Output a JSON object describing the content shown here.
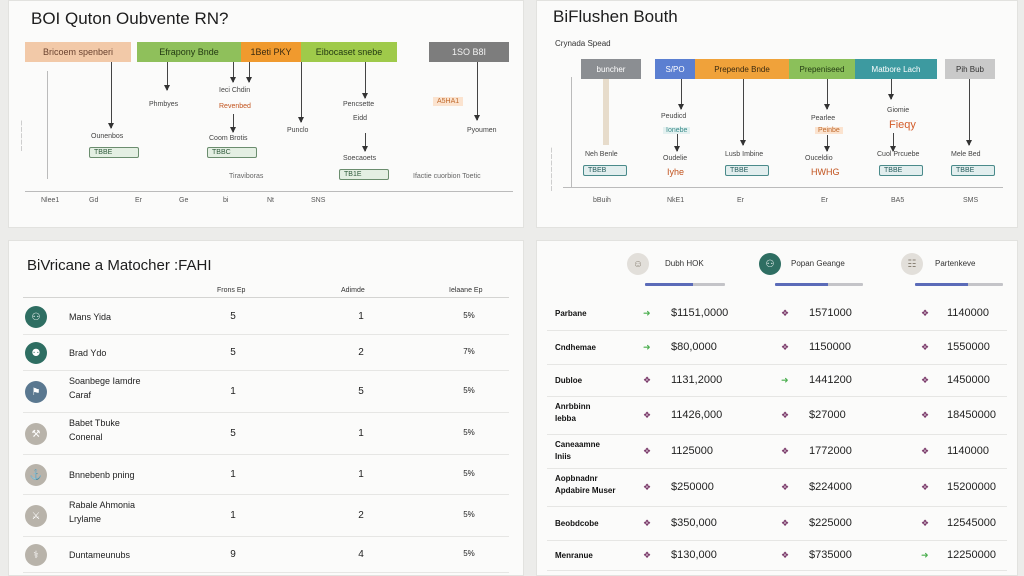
{
  "tl": {
    "title": "BOI Quton Oubvente RN?",
    "bars": [
      "Bricoem spenberi",
      "Efrapony Bnde",
      "1Beti PKY",
      "Eibocaset snebe",
      "1SO B8I"
    ],
    "l1": "Phmbyes",
    "l2a": "Ieci Chdin",
    "l2b": "Revenbed",
    "l3": "Punclo",
    "l4a": "Pencsette",
    "l4b": "Eidd",
    "l5a": "A5HA1",
    "l5b": "Pyoumen",
    "l6": "Ounenbos",
    "l7": "Coom Brotis",
    "l8": "Soecaoets",
    "tag1": "TBBE",
    "tag2": "TBBC",
    "tag3": "TB1E",
    "mid1": "Tiraviboras",
    "mid2": "Ifactie cuorbion Toetic",
    "xt": [
      "Nlee1",
      "Gd",
      "Er",
      "Ge",
      "bi",
      "Nt",
      "SNS"
    ]
  },
  "tr": {
    "title": "BiFlushen Bouth",
    "sub": "Crynada Spead",
    "bars": [
      "buncher",
      "S/PO",
      "Prepende Bnde",
      "Prepeniseed",
      "Matbore Lach",
      "Pih Bub"
    ],
    "la": "Vieste",
    "lb": "Peudicd",
    "lb2": "Ionebe",
    "lc": "Pearlee",
    "lc2": "Peinbe",
    "ld": "Giomie",
    "ld2": "Fieqy",
    "l1": "Neh Benle",
    "l2": "Oudelie",
    "l2b": "Iyhe",
    "l3": "Lusb Imbine",
    "l4": "Ouceldio",
    "l4b": "HWHG",
    "l5": "Cuol Prcuebe",
    "l6": "Mele Bed",
    "tag1": "TBEB",
    "tag2": "TBBE",
    "tag3": "TBBE",
    "tag4": "TBBE",
    "xt": [
      "bBuih",
      "NkE1",
      "Er",
      "Er",
      "BA5",
      "SMS"
    ]
  },
  "bl": {
    "title": "BiVricane a Matocher :FAHI",
    "h1": "Frons Ep",
    "h2": "Adimde",
    "h3": "Ielaane Ep",
    "rows": [
      {
        "n1": "Mans Yida",
        "n2": "",
        "a": "5",
        "b": "1",
        "c": "5%",
        "color": "#2e6e62",
        "glyph": "⚇"
      },
      {
        "n1": "Brad Ydo",
        "n2": "",
        "a": "5",
        "b": "2",
        "c": "7%",
        "color": "#2e6e62",
        "glyph": "⚉"
      },
      {
        "n1": "Soanbege Iamdre",
        "n2": "Caraf",
        "a": "1",
        "b": "5",
        "c": "5%",
        "color": "#5a7890",
        "glyph": "⚑"
      },
      {
        "n1": "Babet Tbuke",
        "n2": "Conenal",
        "a": "5",
        "b": "1",
        "c": "5%",
        "color": "#b8b3aa",
        "glyph": "⚒"
      },
      {
        "n1": "Bnnebenb pning",
        "n2": "",
        "a": "1",
        "b": "1",
        "c": "5%",
        "color": "#b8b3aa",
        "glyph": "⚓"
      },
      {
        "n1": "Rabale Ahmonia",
        "n2": "Lrylame",
        "a": "1",
        "b": "2",
        "c": "5%",
        "color": "#b8b3aa",
        "glyph": "⚔"
      },
      {
        "n1": "Duntameunubs",
        "n2": "",
        "a": "9",
        "b": "4",
        "c": "5%",
        "color": "#b8b3aa",
        "glyph": "⚕"
      }
    ]
  },
  "br": {
    "cols": [
      "Dubh HOK",
      "Popan Geange",
      "Partenkeve"
    ],
    "rows": [
      {
        "n1": "Parbane",
        "n2": "",
        "v": [
          "$1151,0000",
          "1571000",
          "1140000"
        ],
        "d": [
          "up",
          "dn",
          "dn"
        ]
      },
      {
        "n1": "Cndhemae",
        "n2": "",
        "v": [
          "$80,0000",
          "1150000",
          "1550000"
        ],
        "d": [
          "up",
          "dn",
          "dn"
        ]
      },
      {
        "n1": "Dubloe",
        "n2": "",
        "v": [
          "1131,2000",
          "1441200",
          "1450000"
        ],
        "d": [
          "dn",
          "up",
          "dn"
        ]
      },
      {
        "n1": "Anrbbinn",
        "n2": "Iebba",
        "v": [
          "11426,000",
          "$27000",
          "18450000"
        ],
        "d": [
          "dn",
          "dn",
          "dn"
        ]
      },
      {
        "n1": "Caneaamne",
        "n2": "Iniis",
        "v": [
          "1125000",
          "1772000",
          "1140000"
        ],
        "d": [
          "dn",
          "dn",
          "dn"
        ]
      },
      {
        "n1": "Aopbnadnr",
        "n2": "Apdabire Muser",
        "v": [
          "$250000",
          "$224000",
          "15200000"
        ],
        "d": [
          "dn",
          "dn",
          "dn"
        ]
      },
      {
        "n1": "Beobdcobe",
        "n2": "",
        "v": [
          "$350,000",
          "$225000",
          "12545000"
        ],
        "d": [
          "dn",
          "dn",
          "dn"
        ]
      },
      {
        "n1": "Menranue",
        "n2": "",
        "v": [
          "$130,000",
          "$735000",
          "12250000"
        ],
        "d": [
          "dn",
          "dn",
          "up"
        ]
      }
    ]
  }
}
